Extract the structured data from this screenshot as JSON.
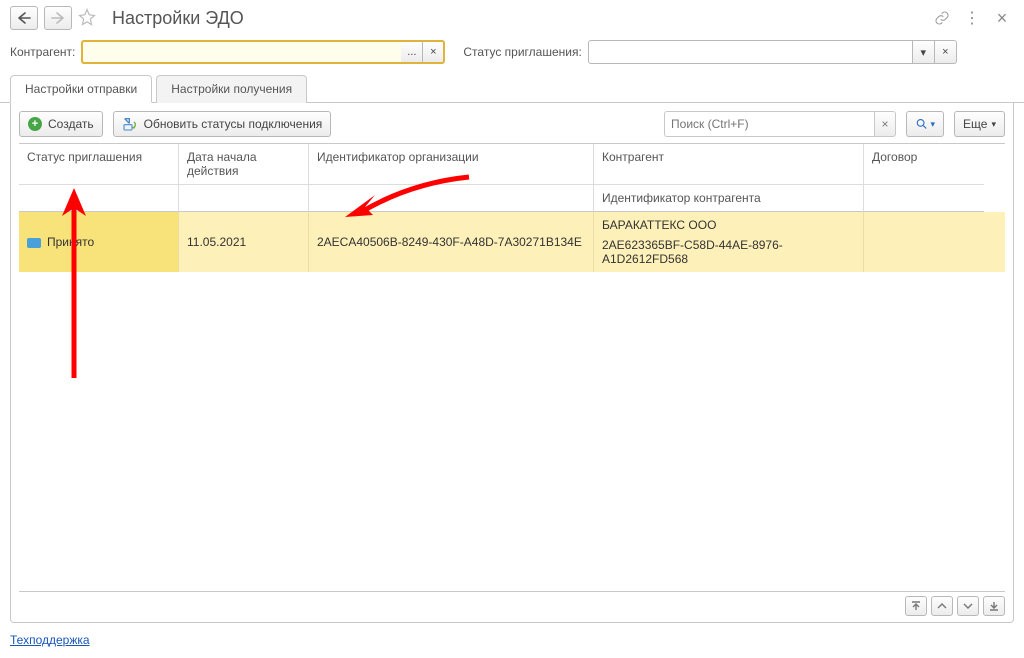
{
  "header": {
    "title": "Настройки ЭДО"
  },
  "filter": {
    "kontr_label": "Контрагент:",
    "kontr_value": "",
    "kontr_dots": "...",
    "kontr_clear": "×",
    "status_label": "Статус приглашения:",
    "status_value": "",
    "status_drop": "▾",
    "status_clear": "×"
  },
  "tabs": {
    "send": "Настройки отправки",
    "receive": "Настройки получения"
  },
  "toolbar": {
    "create": "Создать",
    "refresh": "Обновить статусы подключения",
    "search_placeholder": "Поиск (Ctrl+F)",
    "more": "Еще"
  },
  "table": {
    "headers": {
      "status": "Статус приглашения",
      "date": "Дата начала действия",
      "org_id": "Идентификатор организации",
      "counterparty": "Контрагент",
      "contract": "Договор",
      "counterparty_id": "Идентификатор контрагента"
    },
    "rows": [
      {
        "status": "Принято",
        "date": "11.05.2021",
        "org_id": "2AECA40506B-8249-430F-A48D-7A30271B134E",
        "counterparty_name": "БАРАКАТТЕКС ООО",
        "counterparty_id": "2AE623365BF-C58D-44AE-8976-A1D2612FD568",
        "contract": ""
      }
    ]
  },
  "footer": {
    "support": "Техподдержка"
  },
  "icons": {
    "back": "←",
    "forward": "→",
    "more_dots": "⋮",
    "close": "×",
    "link": "🔗",
    "clear": "×",
    "dropdown": "▾",
    "nav_top": "⤒",
    "nav_up": "▲",
    "nav_down": "▼",
    "nav_bottom": "⤓"
  }
}
